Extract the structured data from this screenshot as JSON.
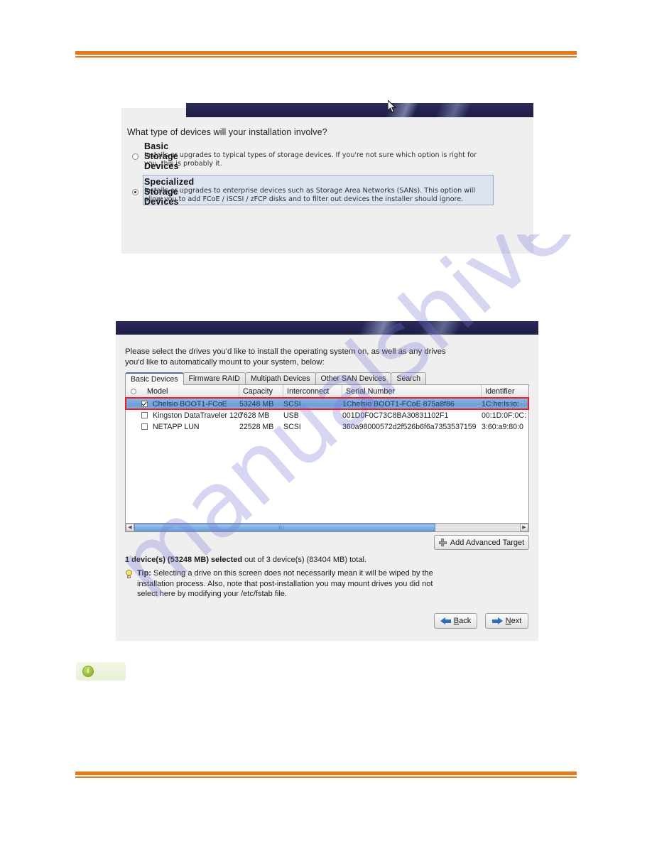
{
  "watermark": {
    "text": "manualshive.com"
  },
  "dialog_type": {
    "question": "What type of devices will your installation involve?",
    "options": [
      {
        "title": "Basic Storage Devices",
        "description": "Installs or upgrades to typical types of storage devices.  If you're not sure which option is right for you, this is probably it.",
        "selected": false
      },
      {
        "title": "Specialized Storage Devices",
        "description": "Installs or upgrades to enterprise devices such as Storage Area Networks (SANs). This option will allow you to add FCoE / iSCSI / zFCP disks and to filter out devices the installer should ignore.",
        "selected": true
      }
    ]
  },
  "dialog_drives": {
    "prompt": "Please select the drives you'd like to install the operating system on, as well as any drives you'd like to automatically mount to your system, below:",
    "tabs": [
      {
        "label": "Basic Devices",
        "active": true
      },
      {
        "label": "Firmware RAID",
        "active": false
      },
      {
        "label": "Multipath Devices",
        "active": false
      },
      {
        "label": "Other SAN Devices",
        "active": false
      },
      {
        "label": "Search",
        "active": false
      }
    ],
    "table": {
      "columns": [
        "Model",
        "Capacity",
        "Interconnect",
        "Serial Number",
        "Identifier"
      ],
      "rows": [
        {
          "checked": true,
          "selected": true,
          "model": "Chelsio BOOT1-FCoE",
          "capacity": "53248 MB",
          "interconnect": "SCSI",
          "serial": "1Chelsio BOOT1-FCoE 875a8f86",
          "identifier": "1C:he:ls:io:"
        },
        {
          "checked": false,
          "selected": false,
          "model": "Kingston DataTraveler 120",
          "capacity": "7628 MB",
          "interconnect": "USB",
          "serial": "001D0F0C73C8BA30831102F1",
          "identifier": "00:1D:0F:0C:"
        },
        {
          "checked": false,
          "selected": false,
          "model": "NETAPP LUN",
          "capacity": "22528 MB",
          "interconnect": "SCSI",
          "serial": "360a98000572d2f526b6f6a7353537159",
          "identifier": "3:60:a9:80:0"
        }
      ]
    },
    "add_advanced_target_label": "Add Advanced Target",
    "status": {
      "bold_part": "1 device(s) (53248 MB) selected",
      "rest_part": " out of 3 device(s) (83404 MB) total."
    },
    "tip": {
      "label": "Tip:",
      "text": " Selecting a drive on this screen does not necessarily mean it will be wiped by the installation process.  Also, note that post-installation you may mount drives you did not select here by modifying your /etc/fstab file."
    },
    "back_label_prefix": "",
    "back_accel": "B",
    "back_label_rest": "ack",
    "next_accel": "N",
    "next_label_rest": "ext"
  },
  "info_badge": {
    "glyph": "i"
  },
  "colors": {
    "accent_orange": "#e87817",
    "dialog_bar": "#242450",
    "row_select_blue": "#6d9fd8",
    "annotation_red": "#ed1c24",
    "badge_green": "#9ec23a"
  }
}
